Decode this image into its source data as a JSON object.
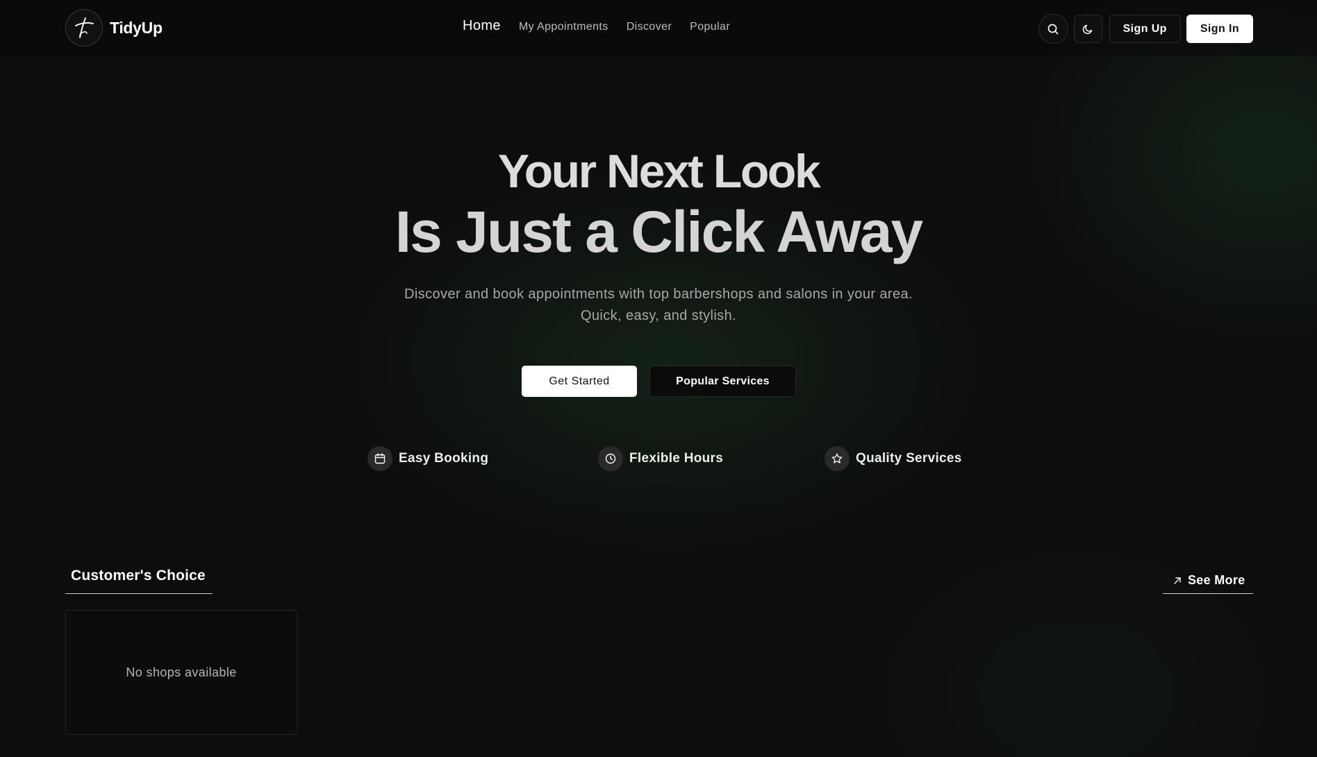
{
  "brand": {
    "name": "TidyUp"
  },
  "nav": {
    "items": [
      {
        "label": "Home",
        "active": true
      },
      {
        "label": "My Appointments",
        "active": false
      },
      {
        "label": "Discover",
        "active": false
      },
      {
        "label": "Popular",
        "active": false
      }
    ]
  },
  "header_actions": {
    "search_icon": "search-icon",
    "theme_icon": "moon-icon",
    "sign_up": "Sign Up",
    "sign_in": "Sign In"
  },
  "hero": {
    "title_line1": "Your Next Look",
    "title_line2": "Is Just a Click Away",
    "subtitle": "Discover and book appointments with top barbershops and salons in your area. Quick, easy, and stylish.",
    "cta_primary": "Get Started",
    "cta_secondary": "Popular Services"
  },
  "features": [
    {
      "icon": "calendar-icon",
      "label": "Easy Booking"
    },
    {
      "icon": "clock-icon",
      "label": "Flexible Hours"
    },
    {
      "icon": "star-icon",
      "label": "Quality Services"
    }
  ],
  "customers_choice": {
    "title": "Customer's Choice",
    "see_more": "See More",
    "empty_message": "No shops available"
  },
  "colors": {
    "background": "#0d0d0d",
    "accent_glow": "#1e4628",
    "primary_button": "#ffffff"
  }
}
